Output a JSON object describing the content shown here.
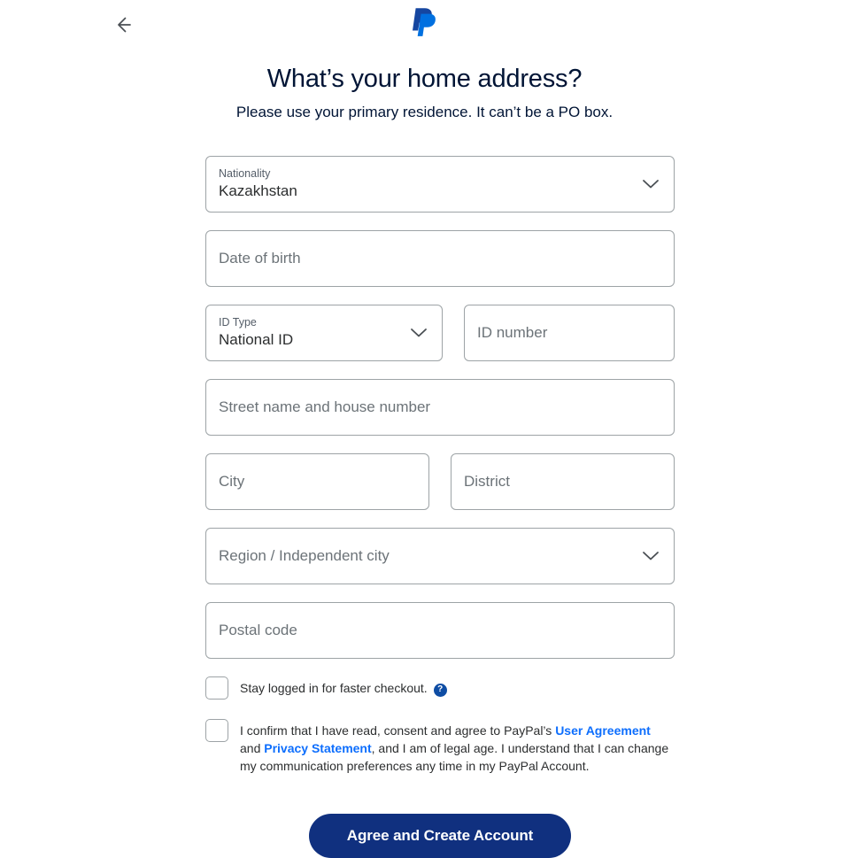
{
  "header": {
    "back_icon": "arrow-left-icon",
    "logo_icon": "paypal-logo-icon",
    "title": "What’s your home address?",
    "subtitle": "Please use your primary residence. It can’t be a PO box."
  },
  "form": {
    "nationality": {
      "label": "Nationality",
      "value": "Kazakhstan",
      "chevron_icon": "chevron-down-icon"
    },
    "date_of_birth": {
      "placeholder": "Date of birth"
    },
    "id_type": {
      "label": "ID Type",
      "value": "National ID",
      "chevron_icon": "chevron-down-icon"
    },
    "id_number": {
      "placeholder": "ID number"
    },
    "street": {
      "placeholder": "Street name and house number"
    },
    "city": {
      "placeholder": "City"
    },
    "district": {
      "placeholder": "District"
    },
    "region": {
      "placeholder": "Region / Independent city",
      "chevron_icon": "chevron-down-icon"
    },
    "postal_code": {
      "placeholder": "Postal code"
    }
  },
  "stay_logged_in": {
    "label": "Stay logged in for faster checkout.",
    "help_icon": "question-mark-icon",
    "help_glyph": "?",
    "checked": false
  },
  "consent": {
    "checked": false,
    "text_part_1": "I confirm that I have read, consent and agree to PayPal’s ",
    "link_user_agreement": "User Agreement",
    "text_part_2": " and ",
    "link_privacy_statement": "Privacy Statement",
    "text_part_3": ", and I am of legal age. I understand that I can change my communication preferences any time in my PayPal Account."
  },
  "cta": {
    "label": "Agree and Create Account"
  },
  "colors": {
    "brand_navy": "#10307f",
    "link_blue": "#0d6efd",
    "title_navy": "#001435",
    "field_border": "#9da3a6",
    "help_blue": "#0e4da4",
    "logo_back_blue": "#1546a0",
    "logo_front_blue": "#0070e0"
  }
}
